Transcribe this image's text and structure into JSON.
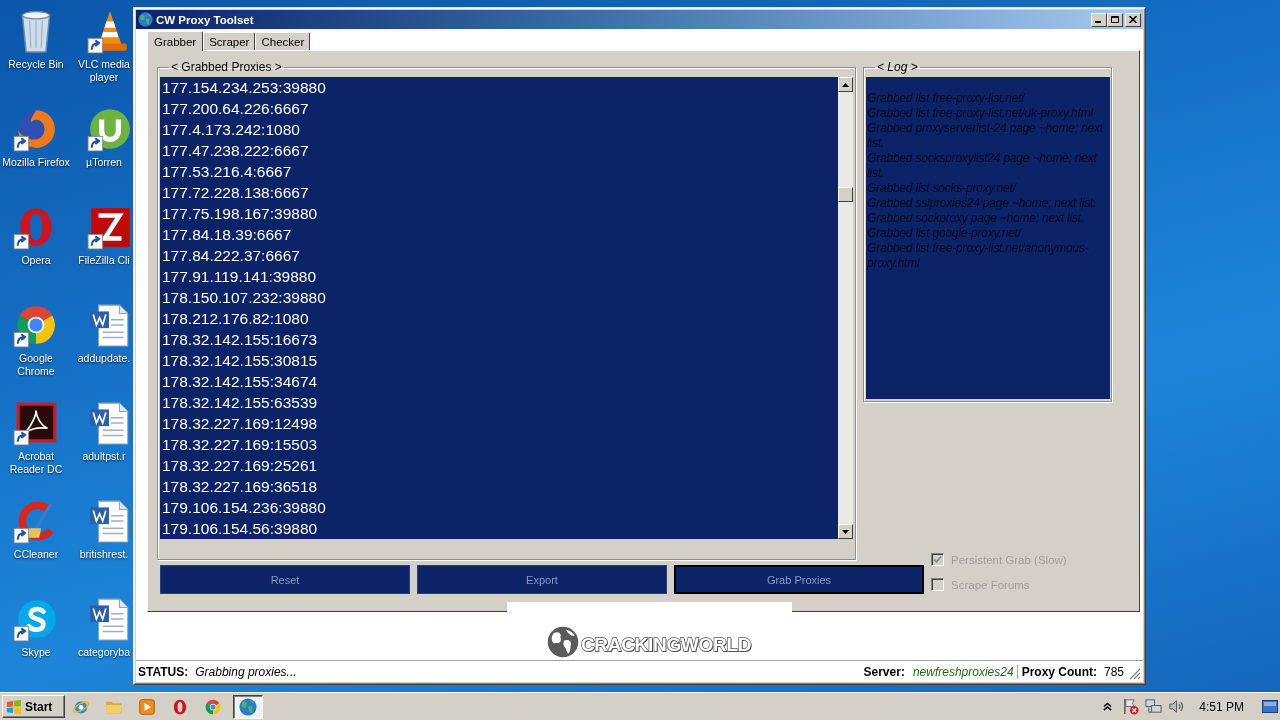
{
  "desktop": {
    "columns": [
      [
        {
          "label": "Recycle Bin",
          "kind": "recycle-bin",
          "shortcut": false
        },
        {
          "label": "Mozilla Firefox",
          "kind": "firefox",
          "shortcut": true
        },
        {
          "label": "Opera",
          "kind": "opera",
          "shortcut": true
        },
        {
          "label": "Google Chrome",
          "kind": "chrome",
          "shortcut": true
        },
        {
          "label": "Acrobat Reader DC",
          "kind": "acrobat",
          "shortcut": true
        },
        {
          "label": "CCleaner",
          "kind": "ccleaner",
          "shortcut": true
        },
        {
          "label": "Skype",
          "kind": "skype",
          "shortcut": true
        }
      ],
      [
        {
          "label": "VLC media player",
          "kind": "vlc",
          "shortcut": true
        },
        {
          "label": "µTorren",
          "kind": "utorrent",
          "shortcut": true
        },
        {
          "label": "FileZilla Cli",
          "kind": "filezilla",
          "shortcut": true
        },
        {
          "label": "addupdate.",
          "kind": "word-doc",
          "shortcut": false
        },
        {
          "label": "adultpst.r",
          "kind": "word-doc",
          "shortcut": false
        },
        {
          "label": "britishrest.",
          "kind": "word-doc",
          "shortcut": false
        },
        {
          "label": "categoryba",
          "kind": "word-doc",
          "shortcut": false
        }
      ]
    ]
  },
  "window": {
    "title": "CW Proxy Toolset"
  },
  "tabs": [
    {
      "label": "Grabber",
      "selected": true
    },
    {
      "label": "Scraper",
      "selected": false
    },
    {
      "label": "Checker",
      "selected": false
    }
  ],
  "proxies": {
    "title": "< Grabbed Proxies >",
    "items": [
      "177.154.234.253:39880",
      "177.200.64.226:6667",
      "177.4.173.242:1080",
      "177.47.238.222:6667",
      "177.53.216.4:6667",
      "177.72.228.138:6667",
      "177.75.198.167:39880",
      "177.84.18.39:6667",
      "177.84.222.37:6667",
      "177.91.119.141:39880",
      "178.150.107.232:39880",
      "178.212.176.82:1080",
      "178.32.142.155:16673",
      "178.32.142.155:30815",
      "178.32.142.155:34674",
      "178.32.142.155:63539",
      "178.32.227.169:12498",
      "178.32.227.169:15503",
      "178.32.227.169:25261",
      "178.32.227.169:36518",
      "179.106.154.236:39880",
      "179.106.154.56:39880"
    ]
  },
  "log": {
    "title": "< Log >",
    "lines": [
      "Grabbed list free-proxy-list.net/",
      "Grabbed list free-proxy-list.net/uk-proxy.html",
      "Grabbed proxyserverlist-24 page ~home; next list.",
      "Grabbed socksproxylist24 page ~home; next list.",
      "Grabbed list socks-proxy.net/",
      "Grabbed sslproxies24 page ~home; next list.",
      "Grabbed sockproxy page ~home; next list.",
      "Grabbed list google-proxy.net/",
      "Grabbed list free-proxy-list.net/anonymous-proxy.html"
    ]
  },
  "buttons": [
    {
      "label": "Reset",
      "default": false
    },
    {
      "label": "Export",
      "default": false
    },
    {
      "label": "Grab Proxies",
      "default": true
    }
  ],
  "options": [
    {
      "label": "Persistent Grab (Slow)",
      "checked": true,
      "disabled": true
    },
    {
      "label": "Scrape Forums",
      "checked": false,
      "disabled": true
    }
  ],
  "logo": {
    "text": "CRACKINGWORLD"
  },
  "status_bar": {
    "status_label": "STATUS:",
    "status": "Grabbing proxies...",
    "server_label": "Server:",
    "server": "newfreshproxies24",
    "count_label": "Proxy Count:",
    "count": "785"
  },
  "taskbar": {
    "start": "Start",
    "items": [
      {
        "kind": "ie",
        "selected": false
      },
      {
        "kind": "explorer",
        "selected": false
      },
      {
        "kind": "media-player",
        "selected": false
      },
      {
        "kind": "opera",
        "selected": false
      },
      {
        "kind": "chrome",
        "selected": false
      },
      {
        "kind": "app",
        "selected": true
      }
    ],
    "clock": "4:51 PM"
  }
}
